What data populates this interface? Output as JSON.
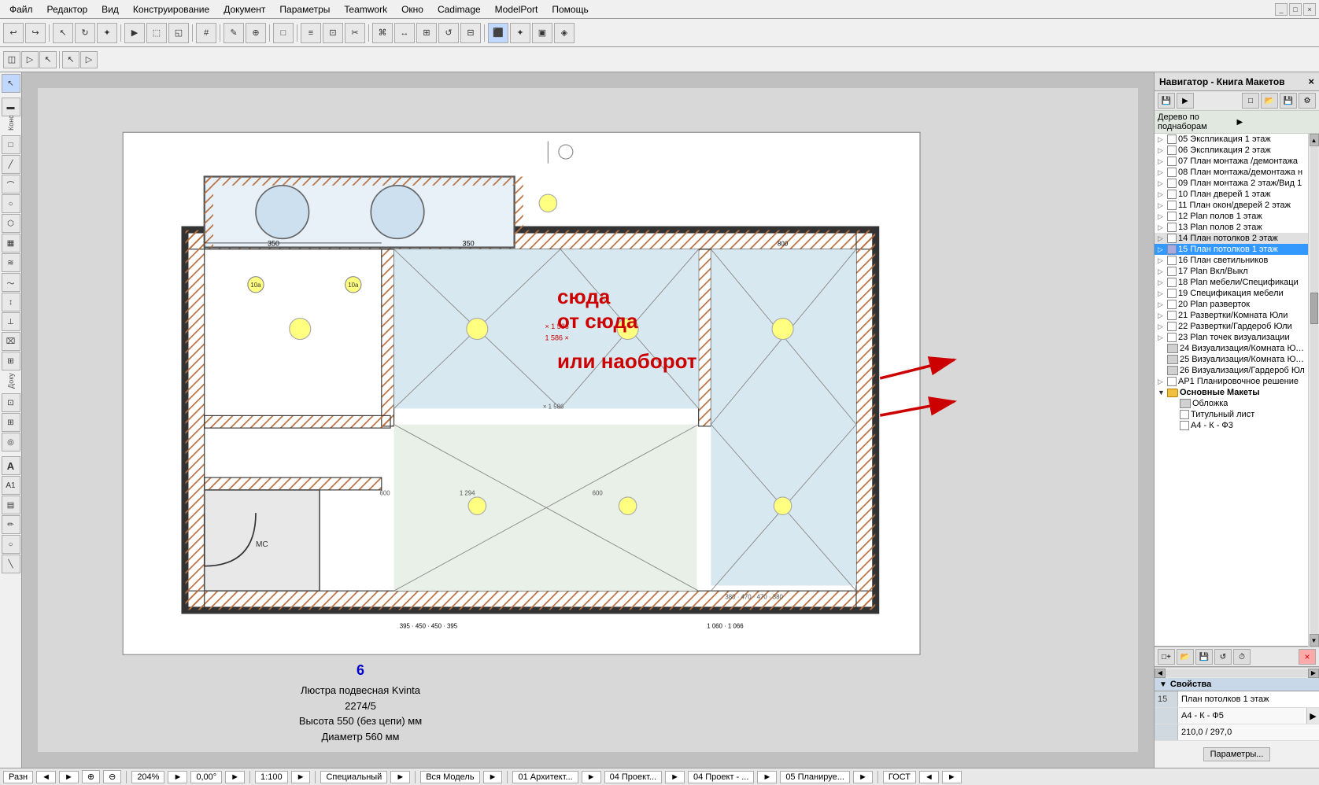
{
  "menubar": {
    "items": [
      "Файл",
      "Редактор",
      "Вид",
      "Конструирование",
      "Документ",
      "Параметры",
      "Teamwork",
      "Окно",
      "Cadimage",
      "ModelPort",
      "Помощь"
    ]
  },
  "window": {
    "title": "Навигатор - Книга Макетов",
    "close": "×"
  },
  "panel": {
    "filter_label": "Дерево по поднаборам",
    "tree_items": [
      {
        "id": "t1",
        "indent": 1,
        "label": "05 Экспликация 1 этаж",
        "type": "doc",
        "selected": false
      },
      {
        "id": "t2",
        "indent": 1,
        "label": "06 Экспликация 2 этаж",
        "type": "doc",
        "selected": false
      },
      {
        "id": "t3",
        "indent": 1,
        "label": "07 План монтажа /демонтажа",
        "type": "doc",
        "selected": false
      },
      {
        "id": "t4",
        "indent": 1,
        "label": "08 План монтажа/демонтажа н",
        "type": "doc",
        "selected": false
      },
      {
        "id": "t5",
        "indent": 1,
        "label": "09 План монтажа 2 этаж/Вид 1",
        "type": "doc",
        "selected": false
      },
      {
        "id": "t6",
        "indent": 1,
        "label": "10 План дверей 1 этаж",
        "type": "doc",
        "selected": false
      },
      {
        "id": "t7",
        "indent": 1,
        "label": "11 План окон/дверей 2 этаж",
        "type": "doc",
        "selected": false
      },
      {
        "id": "t8",
        "indent": 1,
        "label": "12 План полов 1 этаж",
        "type": "doc",
        "selected": false
      },
      {
        "id": "t9",
        "indent": 1,
        "label": "13 План полов 2 этаж",
        "type": "doc",
        "selected": false
      },
      {
        "id": "t10",
        "indent": 1,
        "label": "14 План потолков 2 этаж",
        "type": "doc",
        "selected": false,
        "highlighted": true
      },
      {
        "id": "t11",
        "indent": 1,
        "label": "15 План потолков 1 этаж",
        "type": "doc",
        "selected": true,
        "highlighted": true
      },
      {
        "id": "t12",
        "indent": 1,
        "label": "16 План светильников",
        "type": "doc",
        "selected": false
      },
      {
        "id": "t13",
        "indent": 1,
        "label": "17 План Вкл/Выкл",
        "type": "doc",
        "selected": false
      },
      {
        "id": "t14",
        "indent": 1,
        "label": "18 План мебели/Спецификаци",
        "type": "doc",
        "selected": false
      },
      {
        "id": "t15",
        "indent": 1,
        "label": "19 Спецификация мебели",
        "type": "doc",
        "selected": false
      },
      {
        "id": "t16",
        "indent": 1,
        "label": "20 План разверток",
        "type": "doc",
        "selected": false
      },
      {
        "id": "t17",
        "indent": 1,
        "label": "21 Развертки/Комната Юли",
        "type": "doc",
        "selected": false
      },
      {
        "id": "t18",
        "indent": 1,
        "label": "22 Развертки/Гардероб Юли",
        "type": "doc",
        "selected": false
      },
      {
        "id": "t19",
        "indent": 1,
        "label": "23 План точек визуализации",
        "type": "doc",
        "selected": false
      },
      {
        "id": "t20",
        "indent": 1,
        "label": "24 Визуализация/Комната Юли",
        "type": "img",
        "selected": false
      },
      {
        "id": "t21",
        "indent": 1,
        "label": "25 Визуализация/Комната Юли",
        "type": "img",
        "selected": false
      },
      {
        "id": "t22",
        "indent": 1,
        "label": "26 Визуализация/Гардероб Юл",
        "type": "img",
        "selected": false
      },
      {
        "id": "t23",
        "indent": 1,
        "label": "АР1 Планировочное решение",
        "type": "doc",
        "selected": false
      },
      {
        "id": "t24",
        "indent": 0,
        "label": "Основные Макеты",
        "type": "folder",
        "selected": false
      },
      {
        "id": "t25",
        "indent": 1,
        "label": "Обложка",
        "type": "img",
        "selected": false
      },
      {
        "id": "t26",
        "indent": 1,
        "label": "Титульный лист",
        "type": "doc",
        "selected": false
      },
      {
        "id": "t27",
        "indent": 1,
        "label": "А4 - К - Ф3",
        "type": "doc",
        "selected": false
      }
    ]
  },
  "properties": {
    "header": "Свойства",
    "rows": [
      {
        "key": "15",
        "val": "План потолков 1 этаж",
        "has_arrow": false
      },
      {
        "key": "",
        "val": "А4 - К - Ф5",
        "has_arrow": true
      },
      {
        "key": "",
        "val": "210,0 / 297,0",
        "has_arrow": false
      }
    ],
    "params_btn": "Параметры..."
  },
  "annotations": {
    "text1": "сюда",
    "text2": "от сюда",
    "text3": "или наоборот"
  },
  "statusbar": {
    "items": [
      "Разн",
      "◄",
      "►",
      "⊕",
      "⊖",
      "Q",
      "204%",
      "►",
      "0,00°",
      "►",
      "1:100",
      "►",
      "Специальный",
      "►",
      "Вся Модель",
      "►",
      "01 Архитект...",
      "►",
      "04 Проект...",
      "►",
      "04 Проект - ...",
      "►",
      "05 Планируе...",
      "►",
      "ГОСТ",
      "◄",
      "►"
    ]
  },
  "chandelier": {
    "number": "6",
    "line1": "Люстра подвесная Kvinta",
    "line2": "2274/5",
    "line3": "Высота 550 (без цепи) мм",
    "line4": "Диаметр 560 мм"
  }
}
